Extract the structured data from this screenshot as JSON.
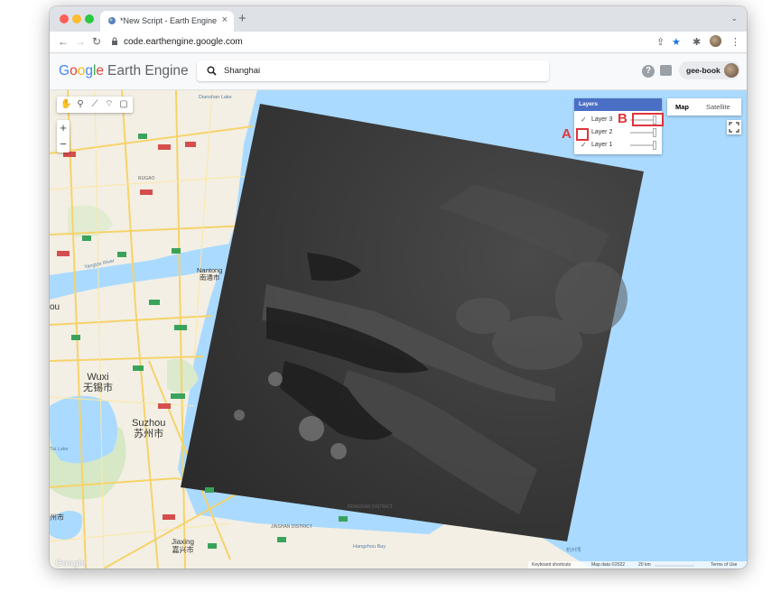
{
  "browser": {
    "tab_title": "*New Script - Earth Engine Co",
    "tab_close": "×",
    "new_tab": "+",
    "url": "code.earthengine.google.com"
  },
  "app": {
    "logo_google": [
      "G",
      "o",
      "o",
      "g",
      "l",
      "e"
    ],
    "logo_product": "Earth Engine",
    "search_value": "Shanghai",
    "help": "?",
    "account": "gee-book"
  },
  "map": {
    "labels": {
      "dianshan": "Dianshan Lake",
      "tai": "Tai Lake",
      "yangtze": "Yangtze River",
      "hangzhou_bay": "Hangzhou Bay",
      "hangzhou_bay_cn": "杭州湾"
    },
    "cities": {
      "nantong": "Nantong",
      "nantong_cn": "南通市",
      "wuxi": "Wuxi",
      "wuxi_cn": "无锡市",
      "suzhou": "Suzhou",
      "suzhou_cn": "苏州市",
      "jiaxing": "Jiaxing",
      "jiaxing_cn": "嘉兴市",
      "huzhou_cn": "州市",
      "you": "ou",
      "rugao": "RUGAO",
      "jinshan": "JINSHAN DISTRICT",
      "fengxian": "FENGXIAN DISTRICT",
      "pinghu": "PINGHU"
    },
    "routes": [
      "G15",
      "G328",
      "G40",
      "G345",
      "G2",
      "G42",
      "S38",
      "G1522",
      "G60",
      "S19",
      "G50",
      "G324"
    ],
    "zoom_in": "+",
    "zoom_out": "−"
  },
  "layers_panel": {
    "title": "Layers",
    "items": [
      {
        "name": "Layer 3",
        "checked": true,
        "opacity": 1.0
      },
      {
        "name": "Layer 2",
        "checked": false,
        "opacity": 1.0
      },
      {
        "name": "Layer 1",
        "checked": true,
        "opacity": 1.0
      }
    ]
  },
  "annotations": {
    "a": "A",
    "b": "B"
  },
  "map_type": {
    "map": "Map",
    "satellite": "Satellite",
    "selected": "Map"
  },
  "attribution": {
    "shortcuts": "Keyboard shortcuts",
    "data": "Map data ©2022",
    "scale": "20 km",
    "terms": "Terms of Use"
  },
  "colors": {
    "water": "#aadaff",
    "layers_header": "#4a6fc4",
    "annotation": "#e0343c"
  }
}
